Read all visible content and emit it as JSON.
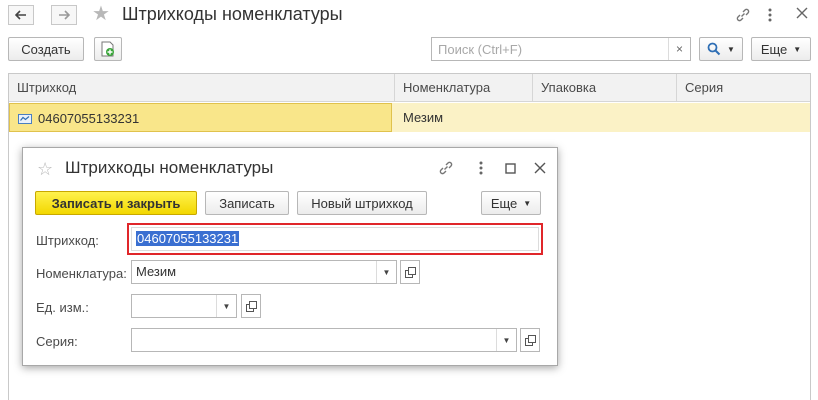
{
  "window": {
    "title": "Штрихкоды номенклатуры"
  },
  "toolbar": {
    "create_label": "Создать",
    "search_placeholder": "Поиск (Ctrl+F)",
    "clear_symbol": "×",
    "more_label": "Еще"
  },
  "table": {
    "columns": [
      "Штрихкод",
      "Номенклатура",
      "Упаковка",
      "Серия"
    ],
    "rows": [
      {
        "barcode": "04607055133231",
        "nomenclature": "Мезим",
        "package": "",
        "series": ""
      }
    ]
  },
  "dialog": {
    "title": "Штрихкоды номенклатуры",
    "buttons": {
      "save_close": "Записать и закрыть",
      "save": "Записать",
      "new_barcode": "Новый штрихкод",
      "more": "Еще"
    },
    "fields": {
      "barcode_label": "Штрихкод:",
      "barcode_value": "04607055133231",
      "nomenclature_label": "Номенклатура:",
      "nomenclature_value": "Мезим",
      "unit_label": "Ед. изм.:",
      "unit_value": "",
      "series_label": "Серия:",
      "series_value": ""
    }
  },
  "colors": {
    "primary_button": "#f5dc00",
    "selected_row": "#fbf2c6",
    "highlight_frame": "#e0262a",
    "text_selection": "#3a6fd1"
  }
}
